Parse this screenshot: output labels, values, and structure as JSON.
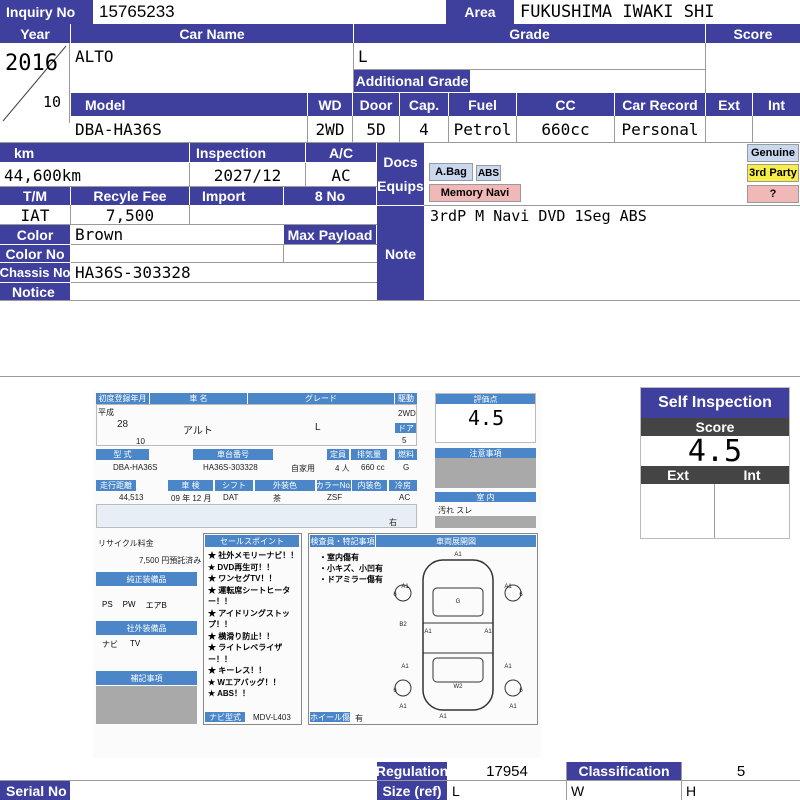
{
  "header": {
    "inquiry_label": "Inquiry No",
    "inquiry_value": "15765233",
    "area_label": "Area",
    "area_value": "FUKUSHIMA IWAKI SHI"
  },
  "car": {
    "year_label": "Year",
    "year_value": "2016",
    "month_value": "10",
    "name_label": "Car Name",
    "name_value": "ALTO",
    "grade_label": "Grade",
    "grade_value": "L",
    "add_grade_label": "Additional Grade",
    "score_label": "Score",
    "model_label": "Model",
    "model_value": "DBA-HA36S",
    "wd_label": "WD",
    "wd_value": "2WD",
    "door_label": "Door",
    "door_value": "5D",
    "cap_label": "Cap.",
    "cap_value": "4",
    "fuel_label": "Fuel",
    "fuel_value": "Petrol",
    "cc_label": "CC",
    "cc_value": "660cc",
    "record_label": "Car Record",
    "record_value": "Personal",
    "ext_label": "Ext",
    "int_label": "Int"
  },
  "details": {
    "km_label": "km",
    "km_value": "44,600km",
    "inspection_label": "Inspection",
    "inspection_value": "2027/12",
    "ac_label": "A/C",
    "ac_value": "AC",
    "docs_label": "Docs",
    "equips_label": "Equips",
    "tm_label": "T/M",
    "tm_value": "IAT",
    "recycle_label": "Recyle Fee",
    "recycle_value": "7,500",
    "import_label": "Import",
    "eightno_label": "8 No",
    "color_label": "Color",
    "color_value": "Brown",
    "maxpayload_label": "Max Payload",
    "colorno_label": "Color No",
    "chassis_label": "Chassis No",
    "chassis_value": "HA36S-303328",
    "notice_label": "Notice",
    "note_label": "Note",
    "note_value": "3rdP M Navi DVD 1Seg ABS"
  },
  "badges": {
    "abag": "A.Bag",
    "abs": "ABS",
    "memory_navi": "Memory Navi",
    "genuine": "Genuine",
    "third_party": "3rd Party",
    "unknown": "?"
  },
  "self_inspection": {
    "title": "Self Inspection",
    "score_label": "Score",
    "score_value": "4.5",
    "ext_label": "Ext",
    "int_label": "Int"
  },
  "sheet": {
    "first_reg": "初度登録年月",
    "car_name": "車 名",
    "grade": "グレード",
    "drive": "駆動",
    "heisei": "平成",
    "year": "28",
    "month": "10",
    "name": "アルト",
    "grade_val": "L",
    "drive_val": "2WD",
    "door": "ドア",
    "door_val": "5",
    "type": "型 式",
    "type_val": "DBA-HA36S",
    "chassis": "車台番号",
    "chassis_val": "HA36S-303328",
    "use": "自家用",
    "cap": "定員",
    "cap_val": "4 人",
    "cc": "排気量",
    "cc_val": "660 cc",
    "fuel": "燃料",
    "fuel_val": "G",
    "km": "走行距離",
    "km_val": "44,513",
    "inspect": "車 検",
    "inspect_val": "09 年 12 月",
    "shift": "シフト",
    "shift_val": "DAT",
    "ext_color": "外装色",
    "ext_color_val": "茶",
    "color_no": "カラーNo.",
    "color_no_val": "ZSF",
    "int_color": "内装色",
    "ac": "冷房",
    "ac_val": "AC",
    "recycle": "リサイクル料金",
    "recycle_val": "7,500 円預託済み",
    "score_title": "評価点",
    "score_val": "4.5",
    "notes_title": "注意事項",
    "interior_title": "室 内",
    "interior_val": "汚れ スレ",
    "sales_title": "セールスポイント",
    "sales_points": [
      "社外メモリーナビ！！",
      "DVD再生可！！",
      "ワンセグTV！！",
      "運転席シートヒーター！！",
      "アイドリングストップ！！",
      "横滑り防止！！",
      "ライトレベライザー！！",
      "キーレス！！",
      "Wエアバッグ！！",
      "ABS！！"
    ],
    "inspector_title": "検査員・特記事項",
    "inspector_notes": [
      "室内傷有",
      "小キズ、小凹有",
      "ドアミラー傷有"
    ],
    "map_title": "車両展開図",
    "genuine_title": "純正装備品",
    "genuine_vals": [
      "PS",
      "PW",
      "エアB"
    ],
    "thirdparty_title": "社外装備品",
    "thirdparty_vals": [
      "ナビ",
      "TV"
    ],
    "supplement_title": "補記事項",
    "navi_type": "ナビ型式",
    "navi_type_val": "MDV-L403",
    "wheel_cap": "ホイール傷",
    "wheel_cap_val": "有",
    "right": "右",
    "damage_marks": [
      "A1",
      "A1",
      "G",
      "A1",
      "A1",
      "B2",
      "A1",
      "A1",
      "A1",
      "A1",
      "W2",
      "A1",
      "A1",
      "6",
      "6",
      "6",
      "6"
    ]
  },
  "footer": {
    "regulation_label": "Regulation",
    "regulation_value": "17954",
    "classification_label": "Classification",
    "classification_value": "5",
    "size_label": "Size (ref)",
    "size_l": "L",
    "size_w": "W",
    "size_h": "H",
    "serial_label": "Serial No"
  }
}
